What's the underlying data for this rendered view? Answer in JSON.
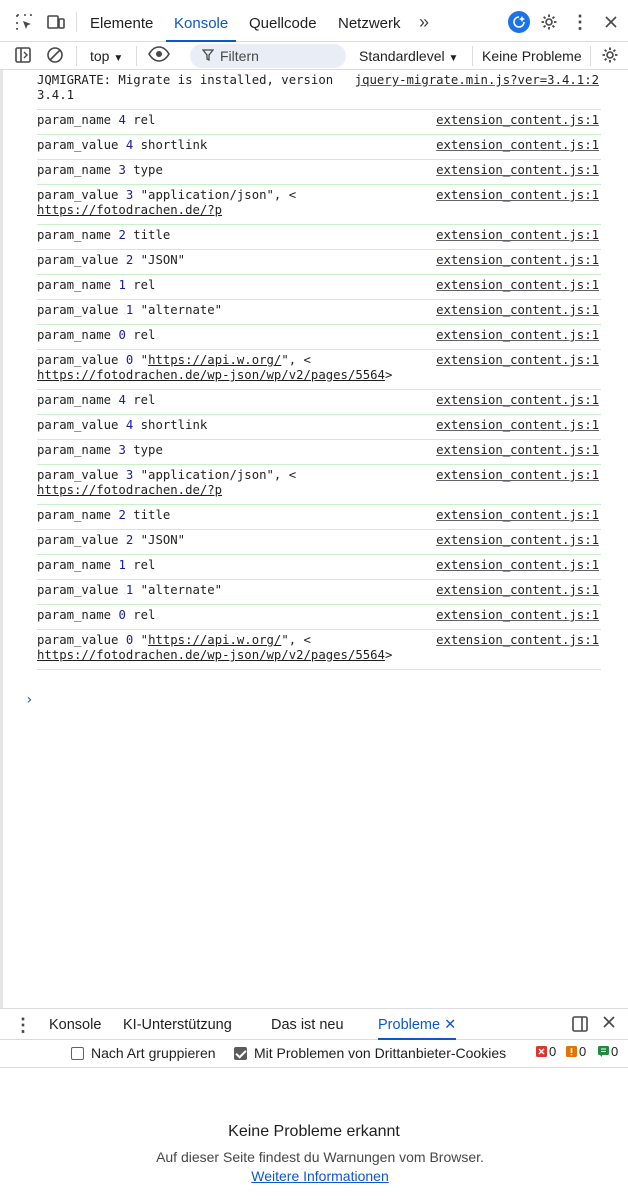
{
  "tabs": [
    "Elemente",
    "Konsole",
    "Quellcode",
    "Netzwerk"
  ],
  "toolbar": {
    "context": "top",
    "filter_placeholder": "Filtern",
    "level": "Standardlevel",
    "issues": "Keine Probleme"
  },
  "log": [
    {
      "msg": "JQMIGRATE: Migrate is installed, version\n3.4.1",
      "src": "jquery-migrate.min.js?ver=3.4.1:2"
    },
    {
      "msg": "param_name 4 rel",
      "src": "extension_content.js:1"
    },
    {
      "msg": "param_value 4 shortlink",
      "src": "extension_content.js:1"
    },
    {
      "msg": "param_name 3 type",
      "src": "extension_content.js:1"
    },
    {
      "msg": "param_value 3 \"application/json\", <\nhttps://fotodrachen.de/?p",
      "src": "extension_content.js:1"
    },
    {
      "msg": "param_name 2 title",
      "src": "extension_content.js:1"
    },
    {
      "msg": "param_value 2 \"JSON\"",
      "src": "extension_content.js:1"
    },
    {
      "msg": "param_name 1 rel",
      "src": "extension_content.js:1"
    },
    {
      "msg": "param_value 1 \"alternate\"",
      "src": "extension_content.js:1"
    },
    {
      "msg": "param_name 0 rel",
      "src": "extension_content.js:1"
    },
    {
      "msg": "param_value 0 \"https://api.w.org/\", <\nhttps://fotodrachen.de/wp-json/wp/v2/pages/5564>",
      "src": "extension_content.js:1"
    },
    {
      "msg": "param_name 4 rel",
      "src": "extension_content.js:1"
    },
    {
      "msg": "param_value 4 shortlink",
      "src": "extension_content.js:1"
    },
    {
      "msg": "param_name 3 type",
      "src": "extension_content.js:1"
    },
    {
      "msg": "param_value 3 \"application/json\", <\nhttps://fotodrachen.de/?p",
      "src": "extension_content.js:1"
    },
    {
      "msg": "param_name 2 title",
      "src": "extension_content.js:1"
    },
    {
      "msg": "param_value 2 \"JSON\"",
      "src": "extension_content.js:1"
    },
    {
      "msg": "param_name 1 rel",
      "src": "extension_content.js:1"
    },
    {
      "msg": "param_value 1 \"alternate\"",
      "src": "extension_content.js:1"
    },
    {
      "msg": "param_name 0 rel",
      "src": "extension_content.js:1"
    },
    {
      "msg": "param_value 0 \"https://api.w.org/\", <\nhttps://fotodrachen.de/wp-json/wp/v2/pages/5564>",
      "src": "extension_content.js:1"
    }
  ],
  "drawer": {
    "tabs": [
      "Konsole",
      "KI-Unterstützung",
      "Das ist neu",
      "Probleme"
    ],
    "group_label": "Nach Art gruppieren",
    "group_checked": false,
    "third_party_label": "Mit Problemen von Drittanbieter-Cookies",
    "third_party_checked": true,
    "errors": "0",
    "warnings": "0",
    "infos": "0",
    "empty_title": "Keine Probleme erkannt",
    "empty_text": "Auf dieser Seite findest du Warnungen vom Browser.",
    "more_info": "Weitere Informationen"
  },
  "colors": {
    "accent": "#0b57d0",
    "row_border": "#c8efc8",
    "number": "#1a1aa6"
  }
}
